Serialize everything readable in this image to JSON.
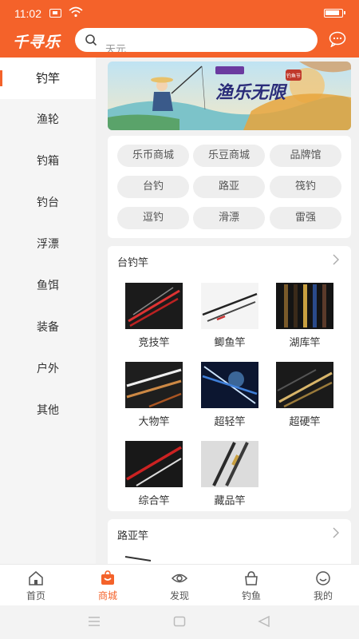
{
  "status": {
    "time": "11:02"
  },
  "header": {
    "logo": "千寻乐",
    "search_placeholder": "天元"
  },
  "sidebar": {
    "items": [
      "钓竿",
      "渔轮",
      "钓箱",
      "钓台",
      "浮漂",
      "鱼饵",
      "装备",
      "户外",
      "其他"
    ]
  },
  "banner": {
    "title": "渔乐无限",
    "badge": "钓鱼节"
  },
  "tags": [
    "乐币商城",
    "乐豆商城",
    "品牌馆",
    "台钓",
    "路亚",
    "筏钓",
    "逗钓",
    "滑漂",
    "雷强"
  ],
  "section1": {
    "title": "台钓竿",
    "products": [
      "竞技竿",
      "鲫鱼竿",
      "湖库竿",
      "大物竿",
      "超轻竿",
      "超硬竿",
      "综合竿",
      "藏品竿"
    ]
  },
  "section2": {
    "title": "路亚竿"
  },
  "bottom_nav": [
    "首页",
    "商城",
    "发现",
    "钓鱼",
    "我的"
  ],
  "colors": {
    "accent": "#f4622a"
  },
  "icons": [
    "sim-icon",
    "wifi-icon",
    "battery-icon",
    "search-icon",
    "chat-icon",
    "chevron-right-icon",
    "home-icon",
    "shop-icon",
    "eye-icon",
    "bag-icon",
    "smile-icon"
  ]
}
